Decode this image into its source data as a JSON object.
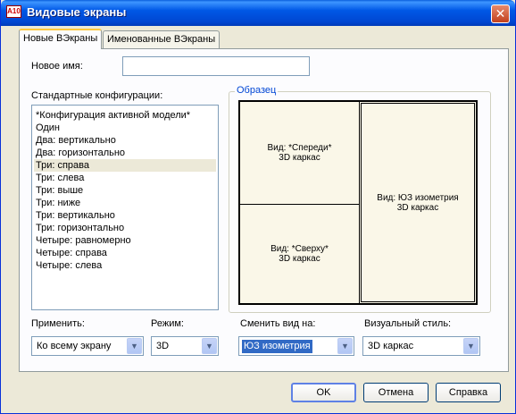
{
  "window": {
    "title": "Видовые экраны",
    "app_icon": "A10",
    "close_glyph": "✕"
  },
  "tabs": [
    {
      "label": "Новые ВЭкраны",
      "active": true
    },
    {
      "label": "Именованные ВЭкраны",
      "active": false
    }
  ],
  "new_name": {
    "label": "Новое имя:",
    "value": ""
  },
  "configs": {
    "label": "Стандартные конфигурации:",
    "items": [
      "*Конфигурация активной модели*",
      "Один",
      "Два: вертикально",
      "Два: горизонтально",
      "Три: справа",
      "Три: слева",
      "Три: выше",
      "Три: ниже",
      "Три: вертикально",
      "Три: горизонтально",
      "Четыре: равномерно",
      "Четыре: справа",
      "Четыре: слева"
    ],
    "selected": "Три: справа"
  },
  "preview": {
    "title": "Образец",
    "viewports": [
      {
        "view": "Вид: *Спереди*",
        "style": "3D каркас"
      },
      {
        "view": "Вид: *Сверху*",
        "style": "3D каркас"
      },
      {
        "view": "Вид: ЮЗ изометрия",
        "style": "3D каркас"
      }
    ]
  },
  "apply": {
    "label": "Применить:",
    "value": "Ко всему экрану"
  },
  "mode": {
    "label": "Режим:",
    "value": "3D"
  },
  "change_view": {
    "label": "Сменить вид на:",
    "value": "ЮЗ изометрия"
  },
  "visual_style": {
    "label": "Визуальный стиль:",
    "value": "3D каркас"
  },
  "buttons": {
    "ok": "OK",
    "cancel": "Отмена",
    "help": "Справка"
  },
  "dropdown_glyph": "▼"
}
